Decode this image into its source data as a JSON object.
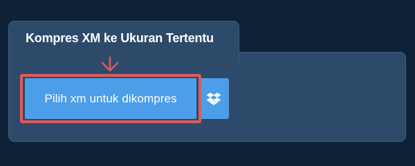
{
  "panel": {
    "title": "Kompres XM ke Ukuran Tertentu"
  },
  "upload": {
    "button_label": "Pilih xm untuk dikompres",
    "cloud_icon": "dropbox-icon"
  },
  "colors": {
    "background": "#0f2136",
    "panel": "#2d4a6b",
    "button": "#4c9ee8",
    "highlight": "#e05a5a"
  }
}
